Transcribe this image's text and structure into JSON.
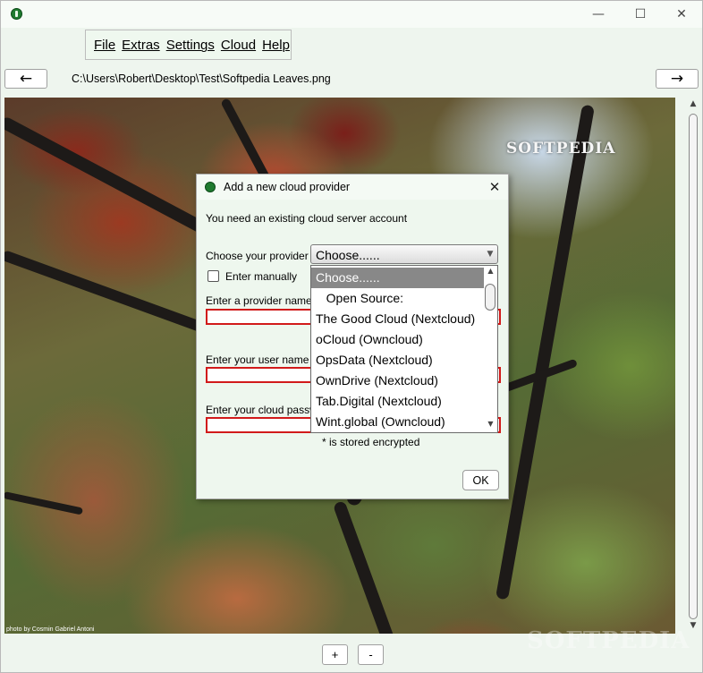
{
  "window": {
    "minimize_glyph": "—",
    "maximize_glyph": "☐",
    "close_glyph": "✕"
  },
  "menu": [
    "File",
    "Extras",
    "Settings",
    "Cloud",
    "Help"
  ],
  "nav": {
    "back_glyph": "←",
    "forward_glyph": "→",
    "path": "C:\\Users\\Robert\\Desktop\\Test\\Softpedia Leaves.png"
  },
  "image": {
    "logo": "SOFTPEDIA",
    "credit": "photo by Cosmin Gabriel Antoni",
    "watermark": "SOFTPEDIA"
  },
  "zoom": {
    "plus": "+",
    "minus": "-"
  },
  "dialog": {
    "title": "Add a new cloud provider",
    "close_glyph": "✕",
    "intro": "You need an existing cloud server account",
    "provider_label": "Choose your provider",
    "enter_manually_label": "Enter manually",
    "provider_name_label": "Enter a provider name",
    "user_name_label": "Enter your user name",
    "password_label": "Enter your cloud password",
    "stored_note": "* is stored encrypted",
    "ok_label": "OK",
    "combo_value": "Choose......",
    "options": [
      "Choose......",
      "   Open Source:",
      "The Good Cloud (Nextcloud)",
      "oCloud (Owncloud)",
      "OpsData (Nextcloud)",
      "OwnDrive (Nextcloud)",
      "Tab.Digital (Nextcloud)",
      "Wint.global (Owncloud)"
    ],
    "selected_index": 0
  }
}
